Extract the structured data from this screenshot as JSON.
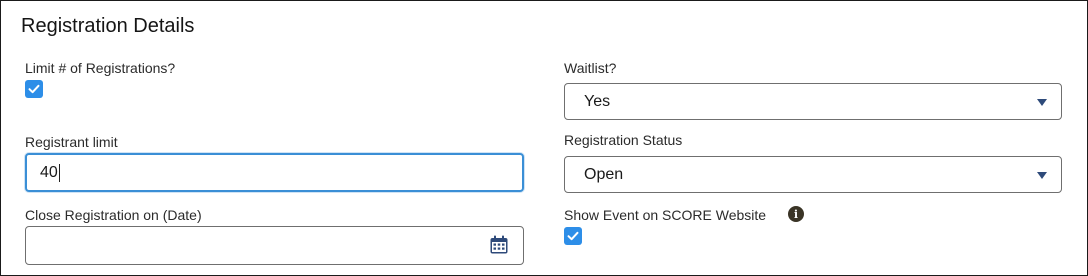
{
  "section": {
    "title": "Registration Details"
  },
  "limit_registrations": {
    "label": "Limit # of Registrations?",
    "checked": true
  },
  "registrant_limit": {
    "label": "Registrant limit",
    "value": "40"
  },
  "close_registration": {
    "label": "Close Registration on (Date)",
    "value": ""
  },
  "waitlist": {
    "label": "Waitlist?",
    "selected": "Yes"
  },
  "registration_status": {
    "label": "Registration Status",
    "selected": "Open"
  },
  "show_event": {
    "label": "Show Event on SCORE Website",
    "info_icon": "i",
    "checked": true
  },
  "colors": {
    "accent": "#2d8ee8",
    "focus_border": "#3a8fd6",
    "chevron": "#2e4a7a",
    "calendar": "#2e4a7a"
  }
}
